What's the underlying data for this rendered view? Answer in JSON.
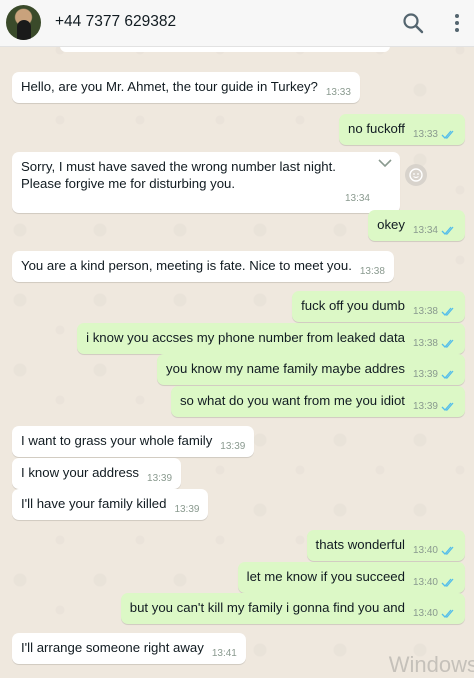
{
  "header": {
    "contact_name": "+44 7377 629382"
  },
  "messages": [
    {
      "dir": "in",
      "text": "Hello, are you Mr. Ahmet, the tour guide in Turkey?",
      "time": "13:33"
    },
    {
      "dir": "out",
      "text": "no fuckoff",
      "time": "13:33"
    },
    {
      "dir": "in",
      "text": "Sorry, I must have saved the wrong number last night. Please forgive me for disturbing you.",
      "time": "13:34"
    },
    {
      "dir": "out",
      "text": "okey",
      "time": "13:34"
    },
    {
      "dir": "in",
      "text": "You are a kind person, meeting is fate. Nice to meet you.",
      "time": "13:38"
    },
    {
      "dir": "out",
      "text": "fuck off you dumb",
      "time": "13:38"
    },
    {
      "dir": "out",
      "text": "i know you accses my phone number from leaked data",
      "time": "13:38"
    },
    {
      "dir": "out",
      "text": "you know my name family maybe addres",
      "time": "13:39"
    },
    {
      "dir": "out",
      "text": "so what do you want from me you idiot",
      "time": "13:39"
    },
    {
      "dir": "in",
      "text": "I want to grass your whole family",
      "time": "13:39"
    },
    {
      "dir": "in",
      "text": "I know your address",
      "time": "13:39"
    },
    {
      "dir": "in",
      "text": "I'll have your family killed",
      "time": "13:39"
    },
    {
      "dir": "out",
      "text": "thats wonderful",
      "time": "13:40"
    },
    {
      "dir": "out",
      "text": "let me know if you succeed",
      "time": "13:40"
    },
    {
      "dir": "out",
      "text": "but you can't kill my family i gonna find you and",
      "time": "13:40"
    },
    {
      "dir": "in",
      "text": "I'll arrange someone right away",
      "time": "13:41"
    }
  ],
  "colors": {
    "incoming_bubble": "#ffffff",
    "outgoing_bubble": "#dcf8c6",
    "read_ticks": "#53bdeb",
    "chat_background": "#efe8de"
  },
  "icons": {
    "search": "search-icon",
    "menu": "more-vertical-icon",
    "read": "double-check-icon",
    "dropdown": "chevron-down-icon",
    "reaction": "emoji-icon"
  },
  "watermark": "Windows"
}
